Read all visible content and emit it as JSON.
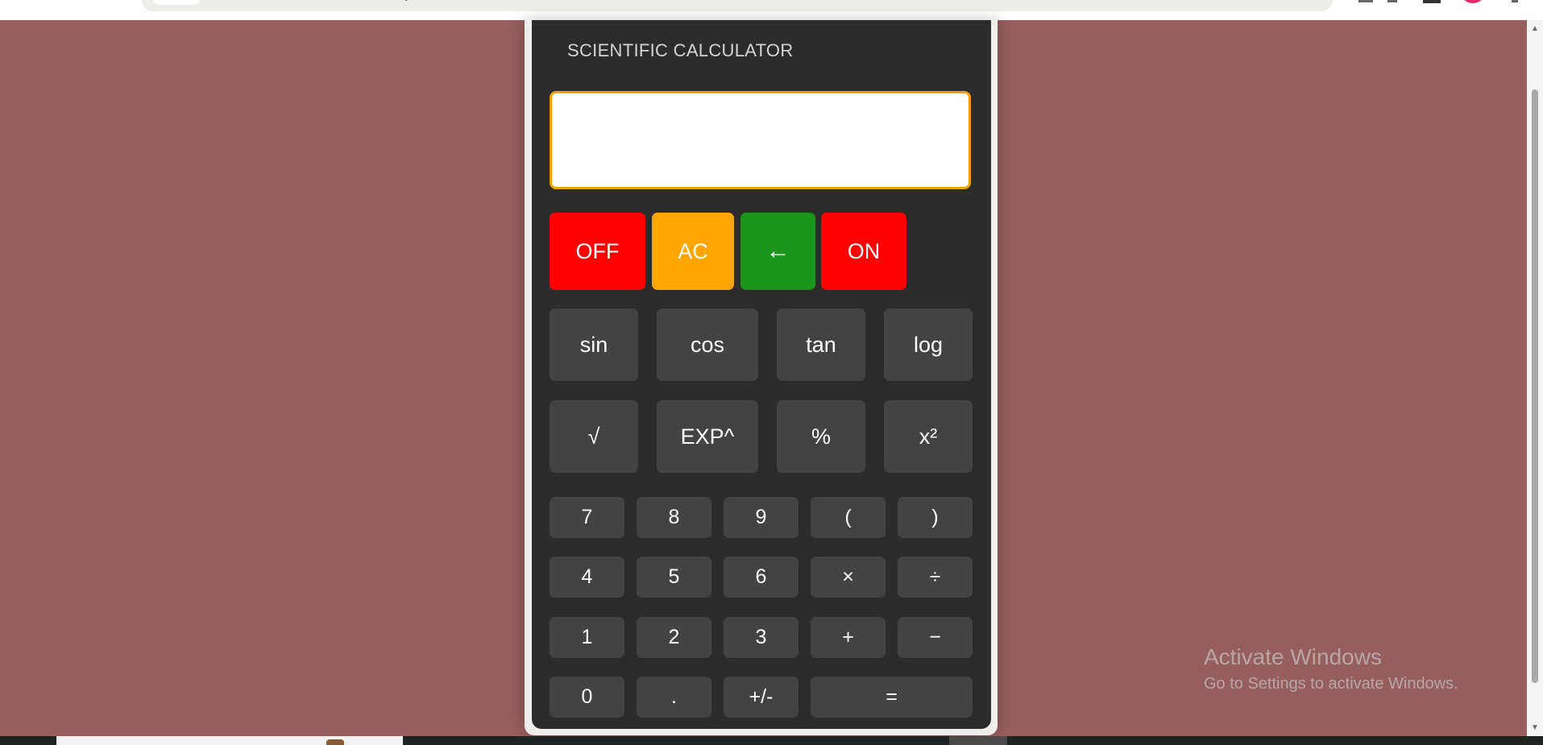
{
  "app": {
    "title": "SCIENTIFIC CALCULATOR"
  },
  "display": {
    "value": ""
  },
  "control_buttons": [
    {
      "label": "OFF",
      "color": "#ff0000"
    },
    {
      "label": "AC",
      "color": "#ffa500"
    },
    {
      "label": "←",
      "color": "#1b961b"
    },
    {
      "label": "ON",
      "color": "#ff0000"
    }
  ],
  "scientific_buttons": [
    {
      "label": "sin"
    },
    {
      "label": "cos"
    },
    {
      "label": "tan"
    },
    {
      "label": "log"
    },
    {
      "label": "√"
    },
    {
      "label": "EXP^"
    },
    {
      "label": "%"
    },
    {
      "label": "x²"
    }
  ],
  "number_buttons": [
    {
      "label": "7"
    },
    {
      "label": "8"
    },
    {
      "label": "9"
    },
    {
      "label": "("
    },
    {
      "label": ")"
    },
    {
      "label": "4"
    },
    {
      "label": "5"
    },
    {
      "label": "6"
    },
    {
      "label": "×"
    },
    {
      "label": "÷"
    },
    {
      "label": "1"
    },
    {
      "label": "2"
    },
    {
      "label": "3"
    },
    {
      "label": "+"
    },
    {
      "label": "−"
    },
    {
      "label": "0"
    },
    {
      "label": "."
    },
    {
      "label": "+/-"
    },
    {
      "label": "="
    }
  ],
  "watermark": {
    "line1": "Activate Windows",
    "line2": "Go to Settings to activate Windows."
  },
  "colors": {
    "page_background": "#975e5e",
    "calculator_body": "#2d2c2c",
    "key": "#434343",
    "display_border": "#f0a000"
  }
}
